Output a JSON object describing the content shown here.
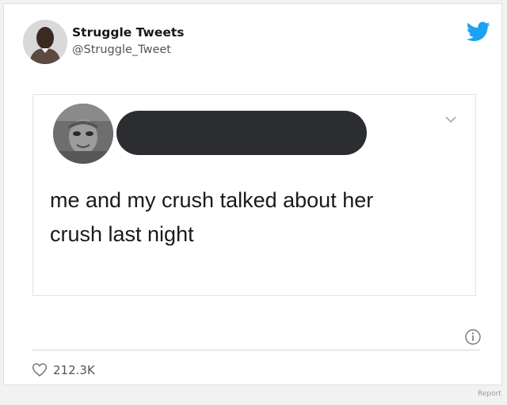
{
  "author": {
    "name": "Struggle Tweets",
    "handle": "@Struggle_Tweet",
    "avatar_icon": "person-photo"
  },
  "brand": {
    "icon": "twitter-bird-icon",
    "color": "#1da1f2"
  },
  "quoted_tweet": {
    "avatar_icon": "statue-photo",
    "name_redacted": true,
    "text_line1": "me and my crush talked about her",
    "text_line2": "crush last night",
    "menu_icon": "chevron-down-icon"
  },
  "footer": {
    "info_icon": "info-icon",
    "like_icon": "heart-icon",
    "like_count": "212.3K"
  },
  "report_label": "Report"
}
